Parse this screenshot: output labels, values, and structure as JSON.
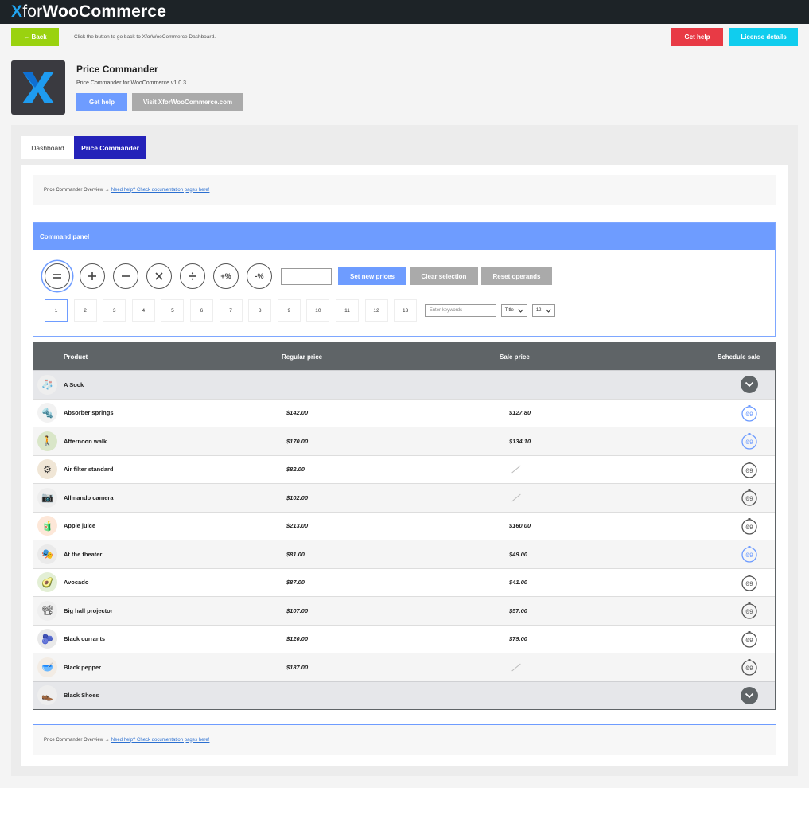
{
  "brand": {
    "x": "X",
    "for": "for",
    "name": "WooCommerce"
  },
  "actionbar": {
    "back_label": "← Back",
    "hint": "Click the button to go back to XforWooCommerce Dashboard.",
    "get_help_label": "Get help",
    "license_label": "License details"
  },
  "plugin": {
    "title": "Price Commander",
    "version": "Price Commander for WooCommerce v1.0.3",
    "get_help_label": "Get help",
    "visit_label": "Visit XforWooCommerce.com"
  },
  "tabs": [
    {
      "label": "Dashboard"
    },
    {
      "label": "Price Commander"
    }
  ],
  "overview": {
    "text": "Price Commander Overview →",
    "link": "Need help? Check documentation pages here!"
  },
  "command_panel": {
    "title": "Command panel",
    "operators": [
      {
        "symbol": "=",
        "icon": "equals-icon"
      },
      {
        "symbol": "+",
        "icon": "plus-icon"
      },
      {
        "symbol": "−",
        "icon": "minus-icon"
      },
      {
        "symbol": "×",
        "icon": "multiply-icon"
      },
      {
        "symbol": "÷",
        "icon": "divide-icon"
      },
      {
        "symbol": "+%",
        "icon": "plus-percent-icon"
      },
      {
        "symbol": "-%",
        "icon": "minus-percent-icon"
      }
    ],
    "set_label": "Set new prices",
    "clear_label": "Clear selection",
    "reset_label": "Reset operands",
    "pages": [
      "1",
      "2",
      "3",
      "4",
      "5",
      "6",
      "7",
      "8",
      "9",
      "10",
      "11",
      "12",
      "13"
    ],
    "active_page": "1",
    "keywords_placeholder": "Enter keywords",
    "sort_value": "Title",
    "per_page_value": "12"
  },
  "table": {
    "headers": {
      "product": "Product",
      "regular": "Regular price",
      "sale": "Sale price",
      "schedule": "Schedule sale"
    },
    "rows": [
      {
        "name": "A Sock",
        "regular": "",
        "sale": "",
        "variable": true,
        "thumb": "🧦"
      },
      {
        "name": "Absorber springs",
        "regular": "$142.00",
        "sale": "$127.80",
        "scheduled": true,
        "thumb": "🔩"
      },
      {
        "name": "Afternoon walk",
        "regular": "$170.00",
        "sale": "$134.10",
        "scheduled": true,
        "thumb": "🚶"
      },
      {
        "name": "Air filter standard",
        "regular": "$82.00",
        "sale": "",
        "scheduled": false,
        "thumb": "⚙"
      },
      {
        "name": "Allmando camera",
        "regular": "$102.00",
        "sale": "",
        "scheduled": false,
        "thumb": "📷"
      },
      {
        "name": "Apple juice",
        "regular": "$213.00",
        "sale": "$160.00",
        "scheduled": false,
        "thumb": "🧃"
      },
      {
        "name": "At the theater",
        "regular": "$81.00",
        "sale": "$49.00",
        "scheduled": true,
        "thumb": "🎭"
      },
      {
        "name": "Avocado",
        "regular": "$87.00",
        "sale": "$41.00",
        "scheduled": false,
        "thumb": "🥑"
      },
      {
        "name": "Big hall projector",
        "regular": "$107.00",
        "sale": "$57.00",
        "scheduled": false,
        "thumb": "📽"
      },
      {
        "name": "Black currants",
        "regular": "$120.00",
        "sale": "$79.00",
        "scheduled": false,
        "thumb": "🫐"
      },
      {
        "name": "Black pepper",
        "regular": "$187.00",
        "sale": "",
        "scheduled": false,
        "thumb": "🥣"
      },
      {
        "name": "Black Shoes",
        "regular": "",
        "sale": "",
        "variable": true,
        "thumb": "👞"
      }
    ]
  },
  "colors": {
    "accent": "#6e9cff",
    "tab_active": "#2422b9",
    "back": "#9ad20f",
    "help": "#e83a45",
    "license": "#10cdee",
    "header_dark": "#5f6467"
  }
}
